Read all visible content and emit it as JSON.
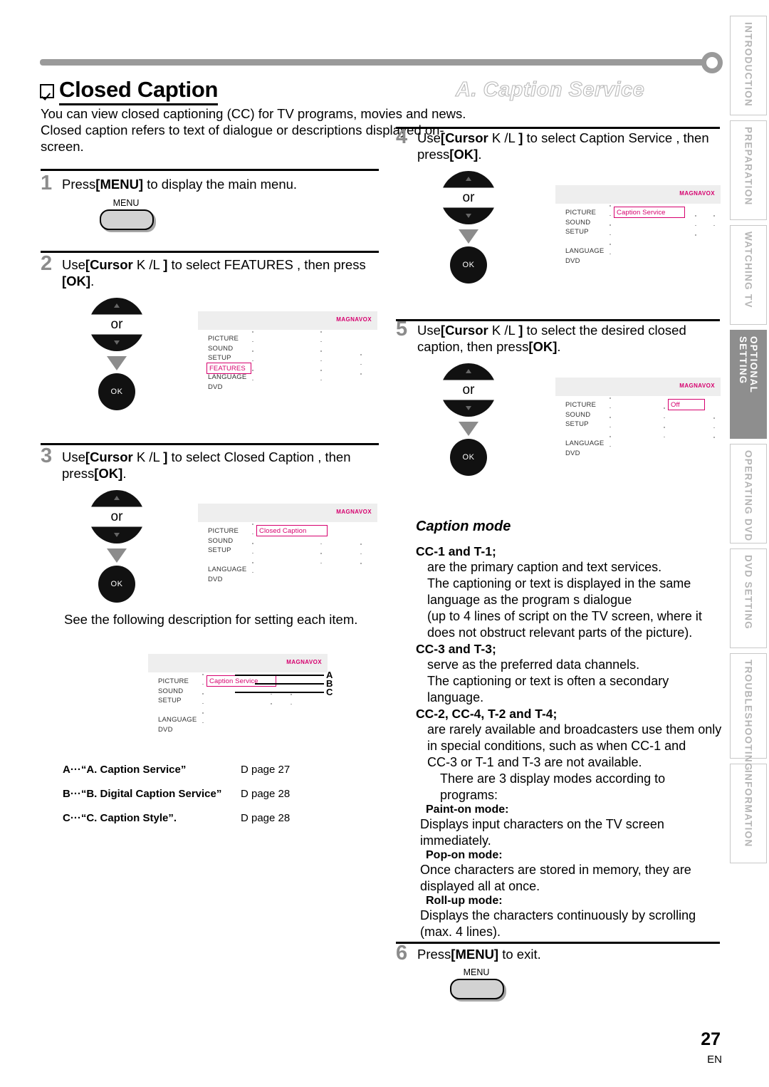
{
  "header": {
    "title": "Closed Caption",
    "section_title": "A. Caption Service",
    "intro": "You can view closed captioning (CC) for TV programs, movies and news. Closed caption refers to text of dialogue or descriptions displayed on-screen."
  },
  "steps": {
    "s1": {
      "num": "1",
      "text_a": "Press",
      "text_b": "[MENU]",
      "text_c": " to display the main menu.",
      "key_label": "MENU"
    },
    "s2": {
      "num": "2",
      "text_a": "Use",
      "text_b": "[Cursor",
      "text_c": " K /L ",
      "text_d": "]",
      "text_e": " to select  FEATURES , then press ",
      "text_f": "[OK]",
      "text_g": "."
    },
    "s3": {
      "num": "3",
      "text_a": "Use",
      "text_b": "[Cursor",
      "text_c": " K /L ",
      "text_d": "]",
      "text_e": " to select  Closed Caption , then press",
      "text_f": "[OK]",
      "text_g": "."
    },
    "s4": {
      "num": "4",
      "text_a": "Use",
      "text_b": "[Cursor",
      "text_c": " K /L ",
      "text_d": "]",
      "text_e": " to select  Caption Service , then press",
      "text_f": "[OK]",
      "text_g": "."
    },
    "s5": {
      "num": "5",
      "text_a": "Use",
      "text_b": "[Cursor",
      "text_c": " K /L ",
      "text_d": "]",
      "text_e": " to select the desired closed caption, then press",
      "text_f": "[OK]",
      "text_g": "."
    },
    "s6": {
      "num": "6",
      "text_a": "Press",
      "text_b": "[MENU]",
      "text_c": " to exit.",
      "key_label": "MENU"
    }
  },
  "note_after_step3": "See the following description for setting each item.",
  "remote": {
    "or_label": "or",
    "ok_label": "OK"
  },
  "tv_menu": {
    "logo": "MAGNAVOX",
    "categories": [
      "PICTURE",
      "SOUND",
      "SETUP",
      "FEATURES",
      "LANGUAGE",
      "DVD"
    ],
    "categories_alt": [
      "PICTURE",
      "SOUND",
      "SETUP",
      "",
      "LANGUAGE",
      "DVD"
    ],
    "selection_features": "FEATURES",
    "selection_closed_caption": "Closed Caption",
    "selection_caption_service": "Caption Service",
    "selection_off": "Off",
    "accent_color": "#d6006e"
  },
  "callouts": {
    "a": "A",
    "b": "B",
    "c": "C"
  },
  "legend": [
    {
      "key": "A···“A. Caption Service”",
      "page": "D page 27"
    },
    {
      "key": "B···“B. Digital Caption Service”",
      "page": "D page 28"
    },
    {
      "key": "C···“C. Caption Style”.",
      "page": "D page 28"
    }
  ],
  "caption_mode": {
    "title": "Caption mode",
    "entries": [
      {
        "term": "CC-1 and T-1;",
        "lines": [
          "are the primary caption and text services.",
          "The captioning or text is displayed in the same",
          "language as the program s dialogue",
          "(up to 4 lines of script on the TV screen, where it",
          "does not obstruct relevant parts of the picture)."
        ]
      },
      {
        "term": "CC-3 and T-3;",
        "lines": [
          "serve as the preferred data channels.",
          "The captioning or text is often a secondary language."
        ]
      },
      {
        "term": "CC-2, CC-4, T-2 and T-4;",
        "lines": [
          "are rarely available and broadcasters use them only",
          "in special conditions, such as when  CC-1  and",
          " CC-3  or  T-1  and  T-3  are not available."
        ]
      }
    ],
    "display_modes_intro": "There are 3 display modes according to programs:",
    "modes": [
      {
        "term": "Paint-on mode:",
        "lines": [
          "Displays input characters on the TV screen",
          "immediately."
        ]
      },
      {
        "term": "Pop-on mode:",
        "lines": [
          "Once characters are stored in memory, they are",
          "displayed all at once."
        ]
      },
      {
        "term": "Roll-up mode:",
        "lines": [
          "Displays the characters continuously by scrolling",
          "(max. 4 lines)."
        ]
      }
    ]
  },
  "side_tabs": [
    {
      "label": "INTRODUCTION",
      "active": false
    },
    {
      "label": "PREPARATION",
      "active": false
    },
    {
      "label": "WATCHING TV",
      "active": false
    },
    {
      "label": "OPTIONAL SETTING",
      "active": true
    },
    {
      "label": "OPERATING DVD",
      "active": false
    },
    {
      "label": "DVD SETTING",
      "active": false
    },
    {
      "label": "TROUBLESHOOTING",
      "active": false
    },
    {
      "label": "INFORMATION",
      "active": false
    }
  ],
  "footer": {
    "page_number": "27",
    "language": "EN"
  }
}
